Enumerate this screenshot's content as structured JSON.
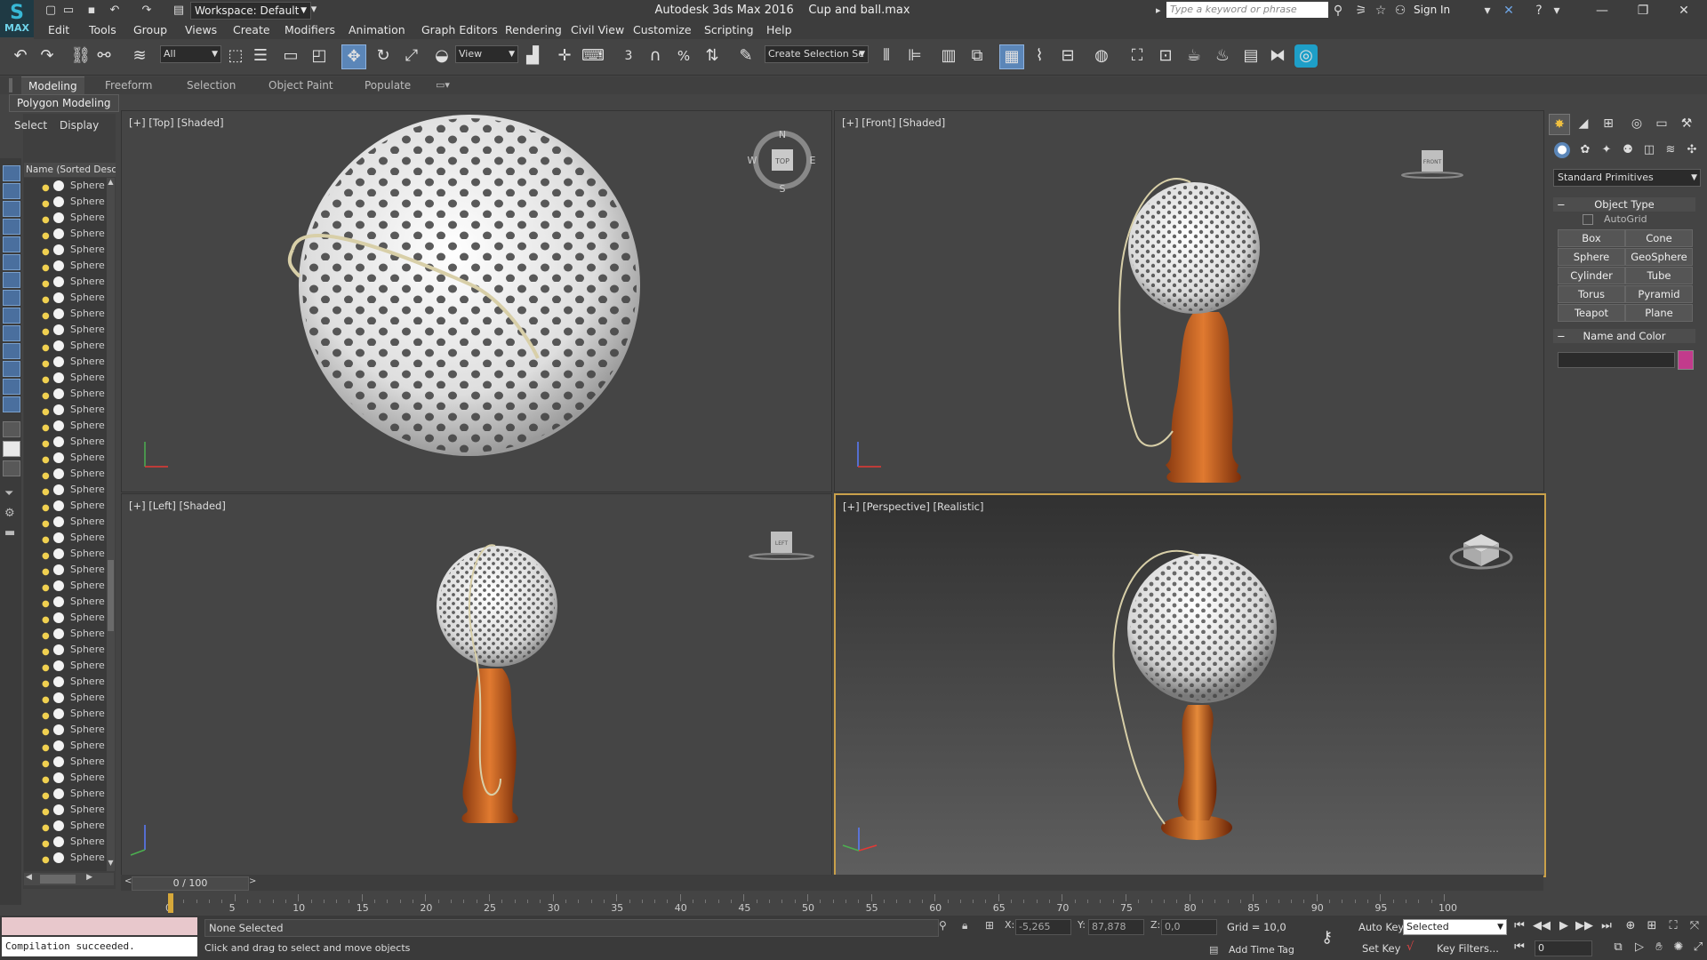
{
  "window": {
    "app_title": "Autodesk 3ds Max 2016",
    "file_name": "Cup and ball.max",
    "workspace": "Workspace: Default",
    "search_placeholder": "Type a keyword or phrase",
    "sign_in": "Sign In",
    "logo_text": "MAX"
  },
  "menu": [
    "Edit",
    "Tools",
    "Group",
    "Views",
    "Create",
    "Modifiers",
    "Animation",
    "Graph Editors",
    "Rendering",
    "Civil View",
    "Customize",
    "Scripting",
    "Help"
  ],
  "toolbar": {
    "filter_all": "All",
    "view_combo": "View",
    "selection_set": "Create Selection Se",
    "snap_3": "3",
    "snap_percent": "%"
  },
  "ribbon": {
    "tabs": [
      "Modeling",
      "Freeform",
      "Selection",
      "Object Paint",
      "Populate"
    ],
    "active": "Modeling",
    "panel": "Polygon Modeling"
  },
  "scene_explorer": {
    "tabs": [
      "Select",
      "Display"
    ],
    "header": "Name (Sorted Descending)",
    "item_label": "Sphere",
    "item_count": 43
  },
  "viewports": {
    "top": "[+] [Top] [Shaded]",
    "front": "[+] [Front] [Shaded]",
    "left": "[+] [Left] [Shaded]",
    "perspective": "[+] [Perspective] [Realistic]",
    "compass": {
      "n": "N",
      "s": "S",
      "e": "E",
      "w": "W",
      "cube": "TOP"
    },
    "front_cube": "FRONT",
    "left_cube": "LEFT"
  },
  "command_panel": {
    "category": "Standard Primitives",
    "object_type_title": "Object Type",
    "autogrid": "AutoGrid",
    "buttons": [
      "Box",
      "Cone",
      "Sphere",
      "GeoSphere",
      "Cylinder",
      "Tube",
      "Torus",
      "Pyramid",
      "Teapot",
      "Plane"
    ],
    "name_color_title": "Name and Color",
    "color": "#c23b8c"
  },
  "timeline": {
    "slider": "0 / 100",
    "ticks": [
      "0",
      "5",
      "10",
      "15",
      "20",
      "25",
      "30",
      "35",
      "40",
      "45",
      "50",
      "55",
      "60",
      "65",
      "70",
      "75",
      "80",
      "85",
      "90",
      "95",
      "100"
    ]
  },
  "status": {
    "maxscript_output": "Compilation succeeded.",
    "selection": "None Selected",
    "prompt": "Click and drag to select and move objects",
    "x_label": "X:",
    "x_value": "-5,265",
    "y_label": "Y:",
    "y_value": "87,878",
    "z_label": "Z:",
    "z_value": "0,0",
    "grid": "Grid = 10,0",
    "add_time_tag": "Add Time Tag",
    "auto_key": "Auto Key",
    "set_key": "Set Key",
    "key_mode": "Selected",
    "key_filters": "Key Filters...",
    "frame": "0"
  }
}
